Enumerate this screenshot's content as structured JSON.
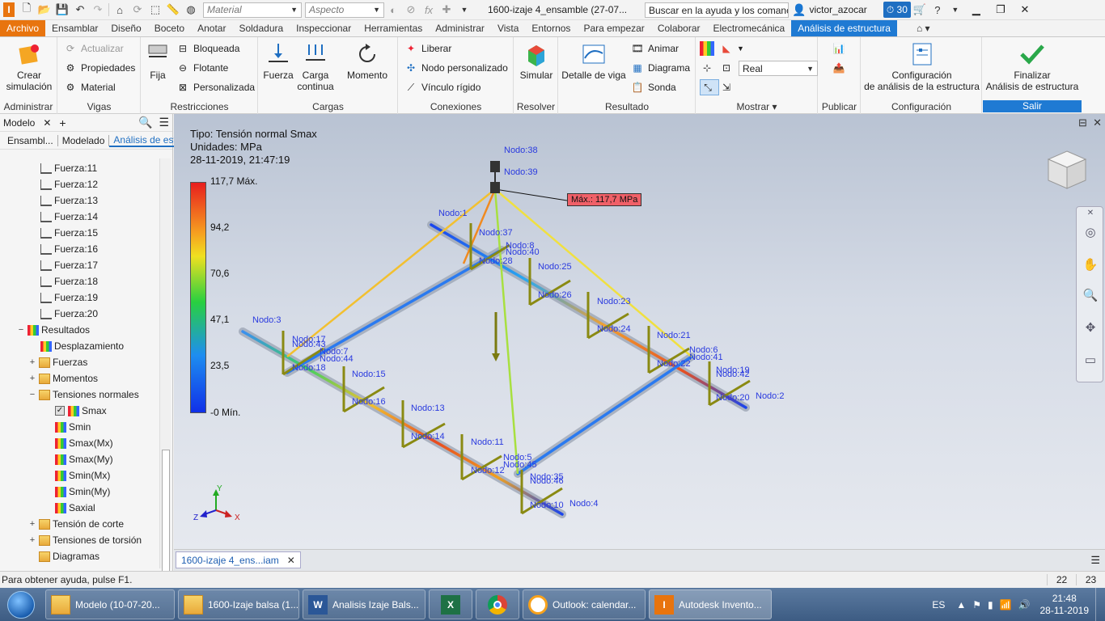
{
  "titlebar": {
    "material_placeholder": "Material",
    "appearance_placeholder": "Aspecto",
    "doc_title": "1600-izaje 4_ensamble (27-07...",
    "help_search": "Buscar en la ayuda y los comanc",
    "user": "victor_azocar",
    "clock_badge": "30"
  },
  "tabs": [
    "Archivo",
    "Ensamblar",
    "Diseño",
    "Boceto",
    "Anotar",
    "Soldadura",
    "Inspeccionar",
    "Herramientas",
    "Administrar",
    "Vista",
    "Entornos",
    "Para empezar",
    "Colaborar",
    "Electromecánica",
    "Análisis de estructura"
  ],
  "ribbon": {
    "administrar": {
      "title": "Administrar",
      "crear": "Crear\nsimulación"
    },
    "vigas": {
      "title": "Vigas",
      "actualizar": "Actualizar",
      "propiedades": "Propiedades",
      "material": "Material"
    },
    "restricciones": {
      "title": "Restricciones",
      "fija": "Fija",
      "bloqueada": "Bloqueada",
      "flotante": "Flotante",
      "personalizada": "Personalizada"
    },
    "cargas": {
      "title": "Cargas",
      "fuerza": "Fuerza",
      "carga_continua": "Carga\ncontinua",
      "momento": "Momento"
    },
    "conexiones": {
      "title": "Conexiones",
      "liberar": "Liberar",
      "nodo_personalizado": "Nodo personalizado",
      "vinculo_rigido": "Vínculo rígido"
    },
    "resolver": {
      "title": "Resolver",
      "simular": "Simular"
    },
    "resultado": {
      "title": "Resultado",
      "detalle_viga": "Detalle de viga",
      "animar": "Animar",
      "diagrama": "Diagrama",
      "sonda": "Sonda"
    },
    "mostrar": {
      "title": "Mostrar",
      "display_mode": "Real"
    },
    "publicar": {
      "title": "Publicar"
    },
    "configuracion": {
      "title": "Configuración",
      "config_label": "Configuración\nde análisis de la estructura"
    },
    "salir": {
      "title": "Salir",
      "finalizar": "Finalizar\nAnálisis de estructura"
    }
  },
  "browser": {
    "title": "Modelo",
    "tabs": [
      "Ensambl...",
      "Modelado",
      "Análisis de estr..."
    ],
    "forces": [
      "Fuerza:11",
      "Fuerza:12",
      "Fuerza:13",
      "Fuerza:14",
      "Fuerza:15",
      "Fuerza:16",
      "Fuerza:17",
      "Fuerza:18",
      "Fuerza:19",
      "Fuerza:20"
    ],
    "resultados": "Resultados",
    "desplazamiento": "Desplazamiento",
    "fuerzas": "Fuerzas",
    "momentos": "Momentos",
    "tensiones_normales": "Tensiones normales",
    "stress_items": [
      "Smax",
      "Smin",
      "Smax(Mx)",
      "Smax(My)",
      "Smin(Mx)",
      "Smin(My)",
      "Saxial"
    ],
    "tension_corte": "Tensión de corte",
    "tensiones_torsion": "Tensiones de torsión",
    "diagramas": "Diagramas"
  },
  "viewport": {
    "tipo": "Tipo: Tensión normal Smax",
    "unidades": "Unidades: MPa",
    "fecha": "28-11-2019, 21:47:19",
    "legend": [
      "117,7 Máx.",
      "94,2",
      "70,6",
      "47,1",
      "23,5",
      "-0 Mín."
    ],
    "max_label": "Máx.: 117,7 MPa",
    "axis_labels": {
      "y": "Y",
      "x": "X",
      "z": "Z"
    },
    "nodes": [
      {
        "t": "Nodo:38"
      },
      {
        "t": "Nodo:39"
      },
      {
        "t": "Nodo:1"
      },
      {
        "t": "Nodo:37"
      },
      {
        "t": "Nodo:8"
      },
      {
        "t": "Nodo:40"
      },
      {
        "t": "Nodo:28"
      },
      {
        "t": "Nodo:25"
      },
      {
        "t": "Nodo:26"
      },
      {
        "t": "Nodo:23"
      },
      {
        "t": "Nodo:24"
      },
      {
        "t": "Nodo:21"
      },
      {
        "t": "Nodo:6"
      },
      {
        "t": "Nodo:41"
      },
      {
        "t": "Nodo:22"
      },
      {
        "t": "Nodo:19"
      },
      {
        "t": "Nodo:42"
      },
      {
        "t": "Nodo:20"
      },
      {
        "t": "Nodo:2"
      },
      {
        "t": "Nodo:3"
      },
      {
        "t": "Nodo:17"
      },
      {
        "t": "Nodo:43"
      },
      {
        "t": "Nodo:7"
      },
      {
        "t": "Nodo:44"
      },
      {
        "t": "Nodo:18"
      },
      {
        "t": "Nodo:15"
      },
      {
        "t": "Nodo:16"
      },
      {
        "t": "Nodo:13"
      },
      {
        "t": "Nodo:14"
      },
      {
        "t": "Nodo:11"
      },
      {
        "t": "Nodo:5"
      },
      {
        "t": "Nodo:45"
      },
      {
        "t": "Nodo:12"
      },
      {
        "t": "Nodo:35"
      },
      {
        "t": "Nodo:46"
      },
      {
        "t": "Nodo:10"
      },
      {
        "t": "Nodo:4"
      }
    ]
  },
  "doc_tab": "1600-izaje 4_ens...iam",
  "statusbar": {
    "help": "Para obtener ayuda, pulse F1.",
    "n1": "22",
    "n2": "23"
  },
  "taskbar": {
    "items": [
      "Modelo (10-07-20...",
      "1600-Izaje balsa (1...",
      "Analisis Izaje Bals...",
      "",
      "",
      "Outlook: calendar...",
      "Autodesk Invento..."
    ],
    "lang": "ES",
    "time": "21:48",
    "date": "28-11-2019"
  }
}
